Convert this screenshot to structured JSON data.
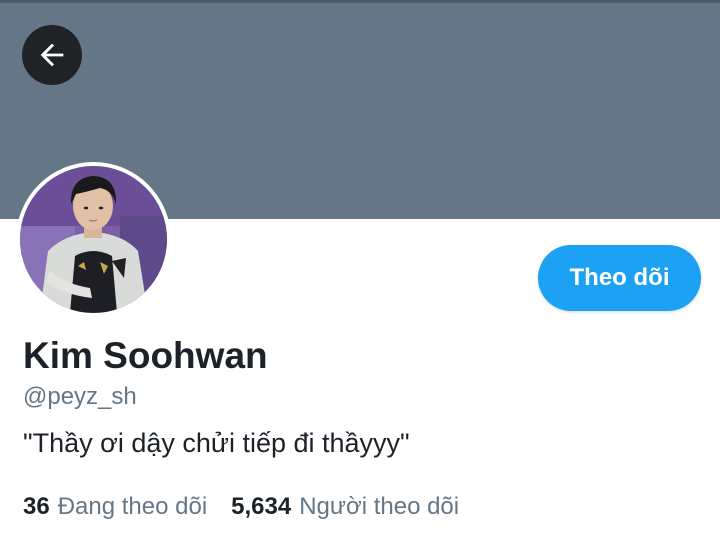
{
  "profile": {
    "display_name": "Kim Soohwan",
    "handle": "@peyz_sh",
    "bio": "\"Thầy ơi dậy chửi tiếp đi thầyyy\""
  },
  "actions": {
    "follow_label": "Theo dõi",
    "back_icon": "arrow-left-icon"
  },
  "stats": {
    "following_count": "36",
    "following_label": "Đang theo dõi",
    "followers_count": "5,634",
    "followers_label": "Người theo dõi"
  },
  "colors": {
    "banner": "#657786",
    "accent": "#1da1f2",
    "text_primary": "#1c2227",
    "text_secondary": "#657786"
  }
}
